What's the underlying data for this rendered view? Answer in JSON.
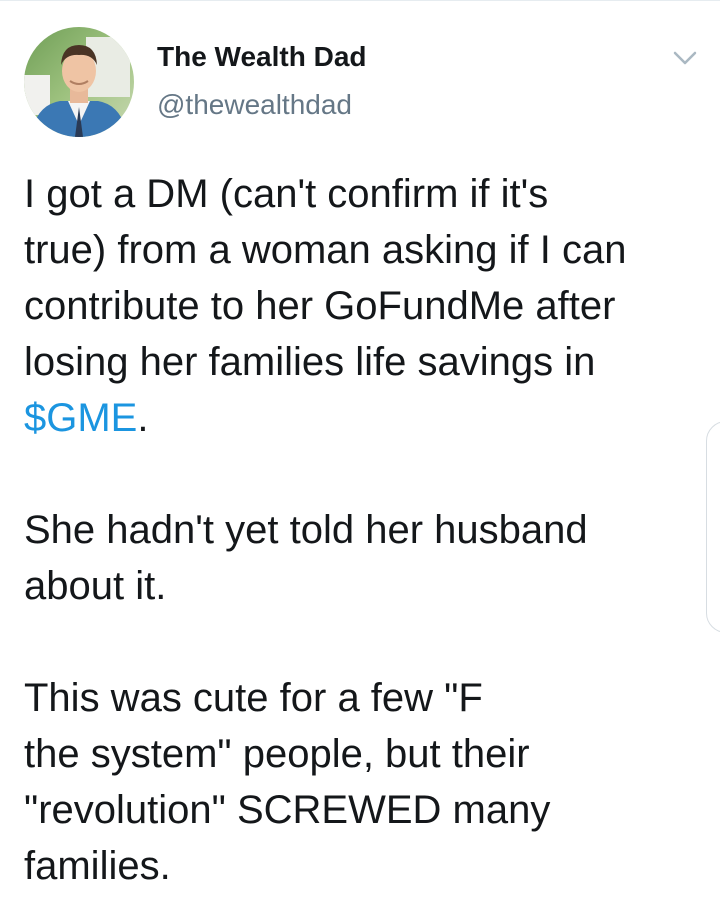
{
  "tweet": {
    "author": {
      "name": "The Wealth Dad",
      "handle": "@thewealthdad"
    },
    "menu_icon": "chevron-down-icon",
    "paragraphs": [
      {
        "lines": [
          "I got a DM (can't confirm if it's",
          "true) from a woman asking if I can",
          "contribute to her GoFundMe after",
          "losing her families life savings in"
        ],
        "cashtag": "$GME",
        "cashtag_suffix": "."
      },
      {
        "lines": [
          "She hadn't yet told her husband",
          "about it."
        ]
      },
      {
        "lines": [
          "This was cute for a few \"F",
          "the system\" people, but their",
          "\"revolution\" SCREWED many",
          "families."
        ]
      }
    ]
  },
  "colors": {
    "text": "#14171a",
    "secondary": "#657786",
    "link": "#1b95e0",
    "divider": "#e6ecf0"
  }
}
